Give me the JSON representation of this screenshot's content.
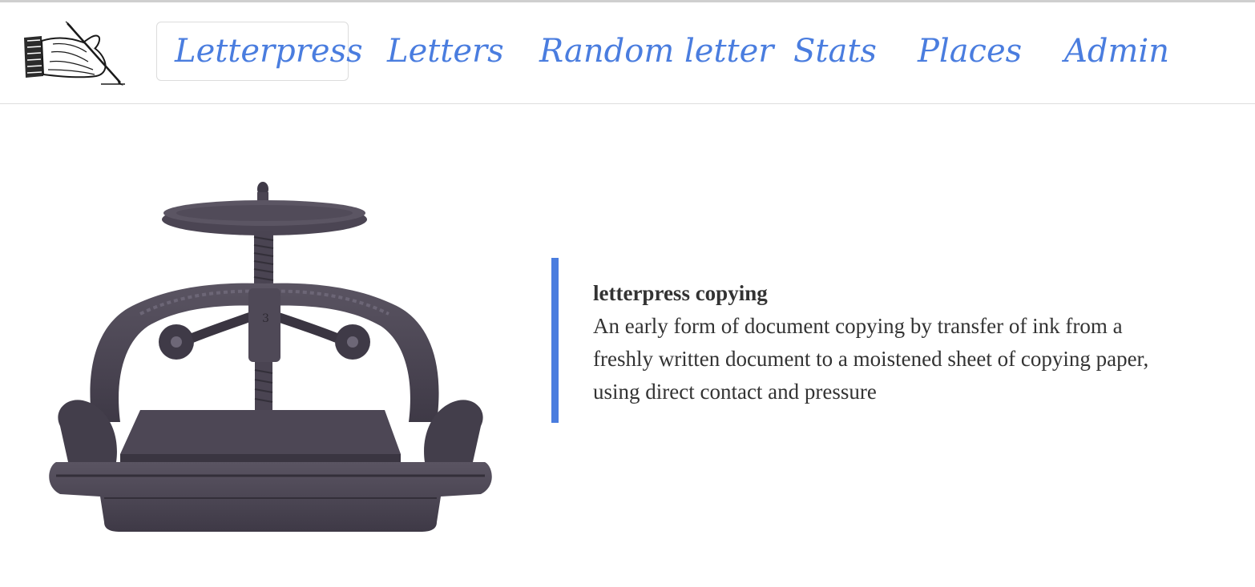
{
  "nav": {
    "items": [
      {
        "label": "Letterpress",
        "active": true
      },
      {
        "label": "Letters",
        "active": false
      },
      {
        "label": "Random letter",
        "active": false
      },
      {
        "label": "Stats",
        "active": false
      },
      {
        "label": "Places",
        "active": false
      },
      {
        "label": "Admin",
        "active": false
      }
    ]
  },
  "logo": {
    "icon": "writing-hand-icon"
  },
  "hero": {
    "image": {
      "icon": "copying-press-image"
    },
    "definition": {
      "term": "letterpress copying",
      "text": "An early form of document copying by transfer of ink from a freshly written document to a moistened sheet of copying paper, using direct contact and pressure"
    }
  },
  "colors": {
    "accent": "#4a7ddf",
    "text": "#333333",
    "press_metal": "#4a4452",
    "border": "#dedede"
  }
}
